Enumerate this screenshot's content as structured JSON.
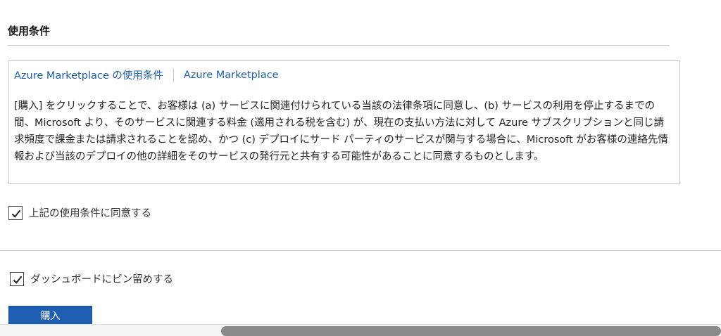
{
  "section": {
    "title": "使用条件"
  },
  "terms": {
    "links": [
      {
        "label": "Azure Marketplace の使用条件"
      },
      {
        "label": "Azure Marketplace"
      }
    ],
    "body": "[購入] をクリックすることで、お客様は (a) サービスに関連付けられている当該の法律条項に同意し、(b) サービスの利用を停止するまでの間、Microsoft より、そのサービスに関連する料金 (適用される税を含む) が、現在の支払い方法に対して Azure サブスクリプションと同じ請求頻度で課金または請求されることを認め、かつ (c) デプロイにサード パーティのサービスが関与する場合に、Microsoft がお客様の連絡先情報および当該のデプロイの他の詳細をそのサービスの発行元と共有する可能性があることに同意するものとします。"
  },
  "agree_checkbox": {
    "label": "上記の使用条件に同意する",
    "checked": true
  },
  "pin_checkbox": {
    "label": "ダッシュボードにピン留めする",
    "checked": true
  },
  "purchase_button": {
    "label": "購入",
    "color": "#1f5fb3"
  },
  "icons": {
    "checkmark": "check-icon"
  },
  "colors": {
    "link": "#1f5fb3",
    "primary_button": "#1f5fb3",
    "border": "#c8c8c8"
  }
}
